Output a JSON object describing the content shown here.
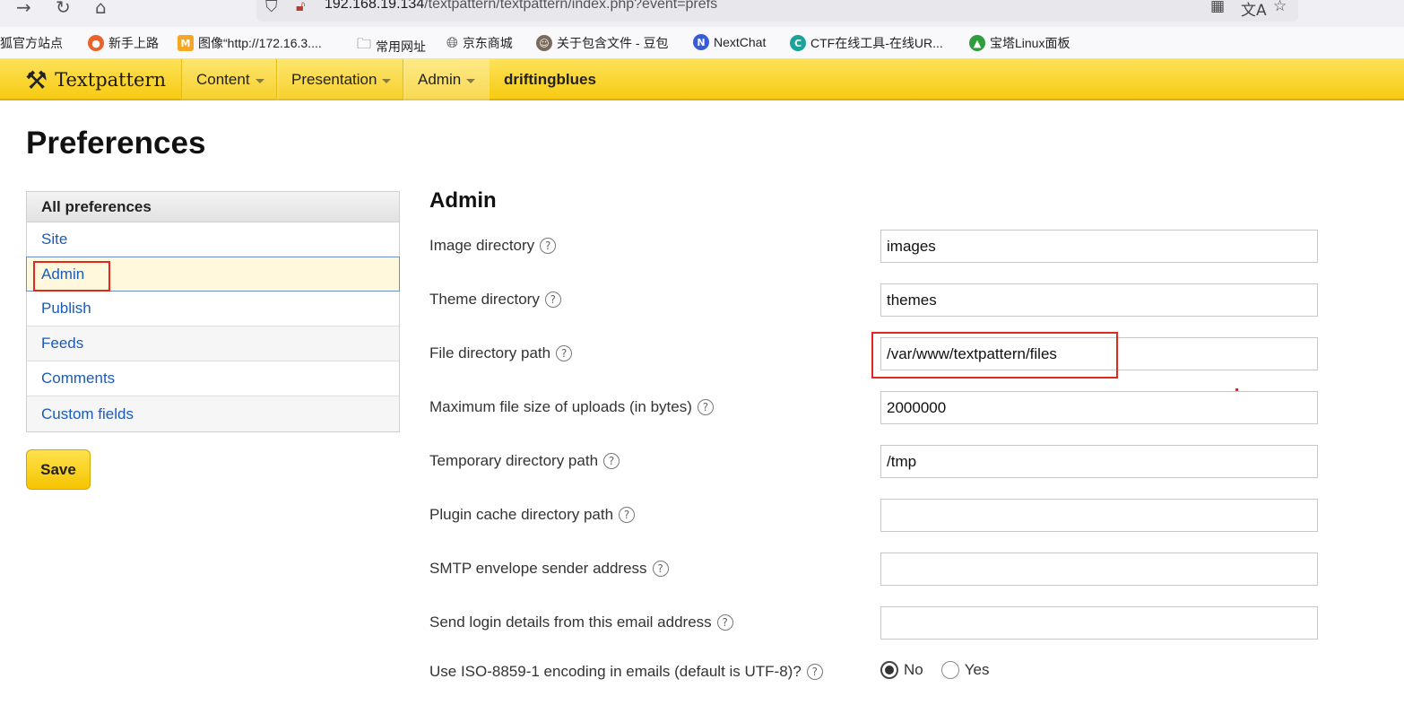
{
  "browser": {
    "url_host": "192.168.19.134",
    "url_path": "/textpattern/textpattern/index.php?event=prefs",
    "bookmarks": [
      {
        "label": "火狐官方站点",
        "icon": "firefox-icon"
      },
      {
        "label": "新手上路",
        "icon": "firefox-icon"
      },
      {
        "label": "图像“http://172.16.3....",
        "icon": "image-icon"
      },
      {
        "label": "常用网址",
        "icon": "folder-icon"
      },
      {
        "label": "京东商城",
        "icon": "globe-icon"
      },
      {
        "label": "关于包含文件 - 豆包",
        "icon": "doubao-icon"
      },
      {
        "label": "NextChat",
        "icon": "nextchat-icon"
      },
      {
        "label": "CTF在线工具-在线UR...",
        "icon": "ctf-icon"
      },
      {
        "label": "宝塔Linux面板",
        "icon": "baota-icon"
      }
    ]
  },
  "header": {
    "logo": "Textpattern",
    "nav": [
      "Content",
      "Presentation",
      "Admin"
    ],
    "site_name": "driftingblues"
  },
  "page": {
    "title": "Preferences",
    "save_label": "Save"
  },
  "sidebar": {
    "heading": "All preferences",
    "items": [
      "Site",
      "Admin",
      "Publish",
      "Feeds",
      "Comments",
      "Custom fields"
    ],
    "active": "Admin"
  },
  "section": {
    "title": "Admin",
    "fields": [
      {
        "label": "Image directory",
        "value": "images"
      },
      {
        "label": "Theme directory",
        "value": "themes"
      },
      {
        "label": "File directory path",
        "value": "/var/www/textpattern/files"
      },
      {
        "label": "Maximum file size of uploads (in bytes)",
        "value": "2000000"
      },
      {
        "label": "Temporary directory path",
        "value": "/tmp"
      },
      {
        "label": "Plugin cache directory path",
        "value": ""
      },
      {
        "label": "SMTP envelope sender address",
        "value": ""
      },
      {
        "label": "Send login details from this email address",
        "value": ""
      }
    ],
    "encoding": {
      "label": "Use ISO-8859-1 encoding in emails (default is UTF-8)?",
      "options": [
        "No",
        "Yes"
      ],
      "selected": "No"
    }
  },
  "colors": {
    "header_yellow": "#f7cb12",
    "link_blue": "#1a5bb8",
    "highlight_red": "#e0281f"
  }
}
